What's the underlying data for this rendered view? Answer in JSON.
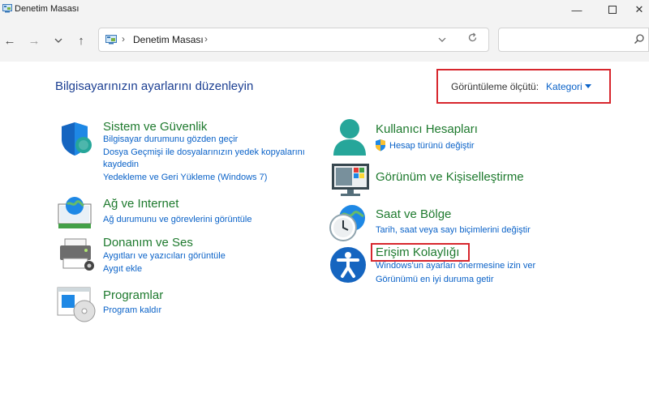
{
  "window": {
    "title": "Denetim Masası"
  },
  "address": {
    "path": "Denetim Masası"
  },
  "search": {
    "placeholder": ""
  },
  "page": {
    "heading": "Bilgisayarınızın ayarlarını düzenleyin"
  },
  "view_by": {
    "label": "Görüntüleme ölçütü:",
    "value": "Kategori"
  },
  "categories": [
    {
      "title": "Sistem ve Güvenlik",
      "links": [
        "Bilgisayar durumunu gözden geçir",
        "Dosya Geçmişi ile dosyalarınızın yedek kopyalarını",
        "kaydedin",
        "Yedekleme ve Geri Yükleme (Windows 7)"
      ],
      "icon": "shield-icon"
    },
    {
      "title": "Ağ ve Internet",
      "links": [
        "Ağ durumunu ve görevlerini görüntüle"
      ],
      "icon": "network-globe-icon"
    },
    {
      "title": "Donanım ve Ses",
      "links": [
        "Aygıtları ve yazıcıları görüntüle",
        "Aygıt ekle"
      ],
      "icon": "printer-icon"
    },
    {
      "title": "Programlar",
      "links": [
        "Program kaldır"
      ],
      "icon": "programs-disc-icon"
    },
    {
      "title": "Kullanıcı Hesapları",
      "links": [
        "Hesap türünü değiştir"
      ],
      "icon": "user-account-icon"
    },
    {
      "title": "Görünüm ve Kişiselleştirme",
      "links": [],
      "icon": "monitor-personalization-icon"
    },
    {
      "title": "Saat ve Bölge",
      "links": [
        "Tarih, saat veya sayı biçimlerini değiştir"
      ],
      "icon": "clock-globe-icon"
    },
    {
      "title": "Erişim Kolaylığı",
      "links": [
        "Windows'un ayarları önermesine izin ver",
        "Görünümü en iyi duruma getir"
      ],
      "icon": "accessibility-icon"
    }
  ],
  "colors": {
    "title_green": "#1e7a2e",
    "link_blue": "#0a62c8",
    "heading_blue": "#1c3f92",
    "highlight_red": "#d7262d"
  }
}
